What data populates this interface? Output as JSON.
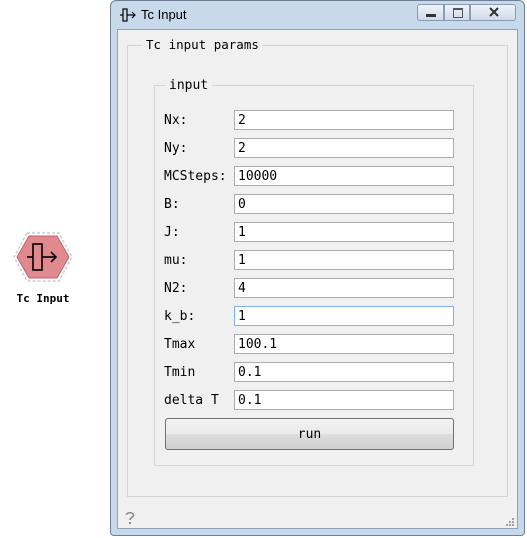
{
  "canvas": {
    "widget_label": "Tc Input"
  },
  "window": {
    "title": "Tc Input",
    "controls": {
      "minimize": "minimize",
      "maximize": "maximize",
      "close": "close"
    }
  },
  "params": {
    "group_title": "Tc input params",
    "input_group_title": "input",
    "fields": [
      {
        "label": "Nx:",
        "value": "2"
      },
      {
        "label": "Ny:",
        "value": "2"
      },
      {
        "label": "MCSteps:",
        "value": "10000"
      },
      {
        "label": "B:",
        "value": "0"
      },
      {
        "label": "J:",
        "value": "1"
      },
      {
        "label": "mu:",
        "value": "1"
      },
      {
        "label": "N2:",
        "value": "4"
      },
      {
        "label": "k_b:",
        "value": "1"
      },
      {
        "label": "Tmax",
        "value": "100.1"
      },
      {
        "label": "Tmin",
        "value": "0.1"
      },
      {
        "label": "delta T",
        "value": "0.1"
      }
    ],
    "run_label": "run"
  },
  "colors": {
    "widget_fill": "#e08a90",
    "window_frame": "#c9d9ec",
    "client_bg": "#f0f0f0",
    "focus_border": "#7eb4ea"
  },
  "icons": {
    "widget": "tc-input-widget-icon",
    "title": "tc-input-title-icon",
    "help": "help-icon"
  }
}
